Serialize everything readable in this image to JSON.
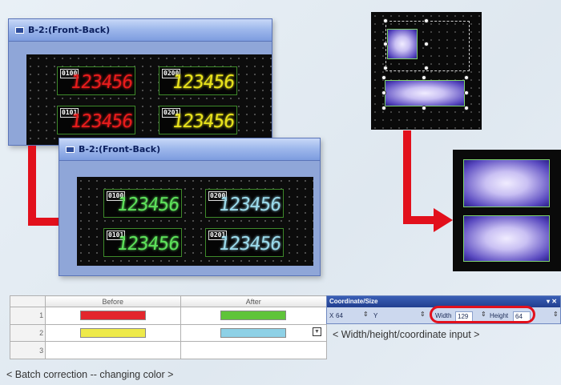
{
  "window1": {
    "title": "B-2:(Front-Back)",
    "displays": [
      {
        "id": "0100",
        "value": "123456",
        "color": "#e81c1c"
      },
      {
        "id": "0200",
        "value": "123456",
        "color": "#e8e21c"
      },
      {
        "id": "0101",
        "value": "123456",
        "color": "#e81c1c"
      },
      {
        "id": "0201",
        "value": "123456",
        "color": "#e8e21c"
      }
    ]
  },
  "window2": {
    "title": "B-2:(Front-Back)",
    "displays": [
      {
        "id": "0100",
        "value": "123456",
        "color": "#5de05a"
      },
      {
        "id": "0200",
        "value": "123456",
        "color": "#9ad9ea"
      },
      {
        "id": "0101",
        "value": "123456",
        "color": "#5de05a"
      },
      {
        "id": "0201",
        "value": "123456",
        "color": "#9ad9ea"
      }
    ]
  },
  "table": {
    "headers": [
      "",
      "Before",
      "After"
    ],
    "rows": [
      {
        "num": "1",
        "before": "#e3262c",
        "after": "#5fc43a"
      },
      {
        "num": "2",
        "before": "#eeea4a",
        "after": "#8ed1e6"
      },
      {
        "num": "3",
        "before": null,
        "after": null
      }
    ],
    "caption": "< Batch correction -- changing color >"
  },
  "coordinate_bar": {
    "title": "Coordinate/Size",
    "x_label": "X",
    "x_value": "64",
    "y_label": "Y",
    "y_value": "",
    "width_label": "Width",
    "width_value": "129",
    "height_label": "Height",
    "height_value": "64",
    "caption": "< Width/height/coordinate input >"
  },
  "colors": {
    "arrow": "#e2101c",
    "window_title_text": "#0b1f5e",
    "highlight": "#e2101c"
  }
}
